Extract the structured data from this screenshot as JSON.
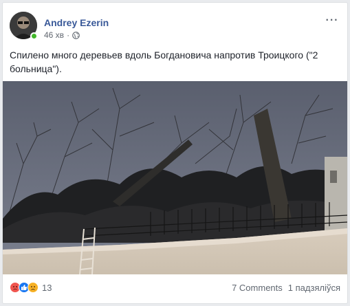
{
  "post": {
    "author": "Andrey Ezerin",
    "time": "46 хв",
    "text": "Спилено много деревьев вдоль Богдановича напротив Троицкого (\"2 больница\").",
    "more_icon": "ellipsis-icon",
    "privacy_icon": "globe-icon"
  },
  "footer": {
    "reaction_icons": [
      "angry-icon",
      "like-icon",
      "sad-icon"
    ],
    "reaction_count": "13",
    "comments": "7 Comments",
    "shares": "1 падзяліўся"
  },
  "colors": {
    "author_link": "#385898",
    "online": "#42b72a",
    "like": "#1877f2",
    "angry": "#f0554f",
    "sad": "#f7b125"
  }
}
